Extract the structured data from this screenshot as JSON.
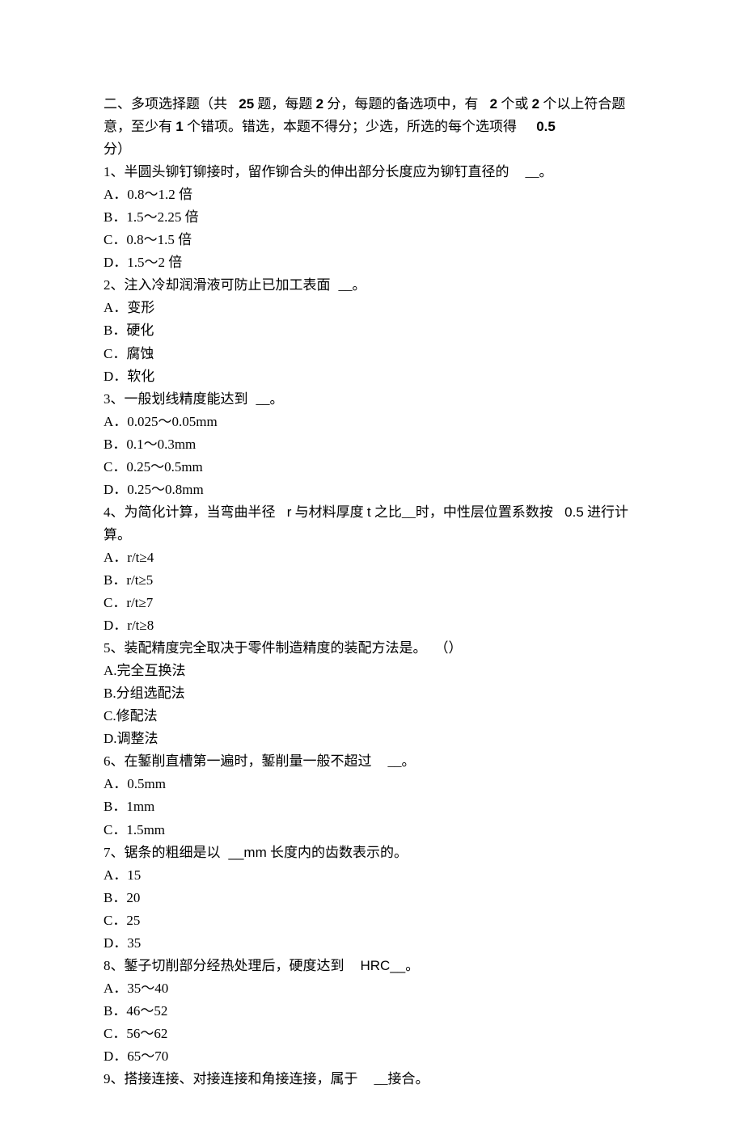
{
  "section": {
    "pre1": "二、多项选择题（共",
    "num1": "25",
    "t2": "题，每题",
    "num2": "2",
    "t3": "分，每题的备选项中，有",
    "num3": "2",
    "t4": "个或",
    "num4": "2",
    "t5": "个以上符合题意，至少有",
    "num5": "1",
    "t6": "个错项。错选，本题不得分；少选，所选的每个选项得",
    "num6": "0.5",
    "t7": "分）"
  },
  "q1": {
    "prompt_a": "1、半圆头铆钉铆接时，留作铆合头的伸出部分长度应为铆钉直径的",
    "prompt_b": "__。",
    "A": "A．0.8～1.2 倍",
    "B": "B．1.5～2.25 倍",
    "C": "C．0.8～1.5 倍",
    "D": "D．1.5～2 倍"
  },
  "q2": {
    "prompt_a": "2、注入冷却润滑液可防止已加工表面",
    "prompt_b": "__。",
    "A": "A．变形",
    "B": "B．硬化",
    "C": "C．腐蚀",
    "D": "D．软化"
  },
  "q3": {
    "prompt_a": "3、一般划线精度能达到",
    "prompt_b": "__。",
    "A": "A．0.025～0.05mm",
    "B": "B．0.1～0.3mm",
    "C": "C．0.25～0.5mm",
    "D": "D．0.25～0.8mm"
  },
  "q4": {
    "prompt_a": "4、为简化计算，当弯曲半径",
    "prompt_r": "r",
    "prompt_b": "与材料厚度",
    "prompt_t": "t",
    "prompt_c": "之比__时，中性层位置系数按",
    "prompt_05": "0.5",
    "prompt_d": "进行计算。",
    "A": "A．r/t≥4",
    "B": "B．r/t≥5",
    "C": "C．r/t≥7",
    "D": "D．r/t≥8"
  },
  "q5": {
    "prompt_a": "5、装配精度完全取决于零件制造精度的装配方法是。",
    "prompt_b": "（）",
    "A": "A.完全互换法",
    "B": "B.分组选配法",
    "C": "C.修配法",
    "D": "D.调整法"
  },
  "q6": {
    "prompt_a": "6、在錾削直槽第一遍时，錾削量一般不超过",
    "prompt_b": "__。",
    "A": "A．0.5mm",
    "B": "B．1mm",
    "C": "C．1.5mm"
  },
  "q7": {
    "prompt_a": "7、锯条的粗细是以",
    "prompt_b": "__mm",
    "prompt_c": "长度内的齿数表示的。",
    "A": "A．15",
    "B": "B．20",
    "C": "C．25",
    "D": "D．35"
  },
  "q8": {
    "prompt_a": "8、錾子切削部分经热处理后，硬度达到",
    "prompt_b": "HRC__",
    "prompt_c": "。",
    "A": "A．35～40",
    "B": "B．46～52",
    "C": "C．56～62",
    "D": "D．65～70"
  },
  "q9": {
    "prompt_a": "9、搭接连接、对接连接和角接连接，属于",
    "prompt_b": "__接合。"
  }
}
